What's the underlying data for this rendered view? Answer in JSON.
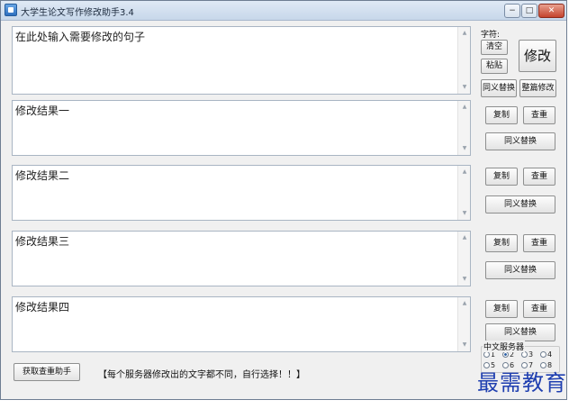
{
  "window": {
    "title": "大学生论文写作修改助手3.4",
    "controls": {
      "minimize": "−",
      "maximize": "□",
      "close": "✕"
    }
  },
  "input": {
    "placeholder": "在此处输入需要修改的句子"
  },
  "side_panel": {
    "char_label": "字符:",
    "clear": "清空",
    "paste": "粘贴",
    "modify": "修改",
    "synonym_replace": "同义替换",
    "whole_modify": "整篇修改"
  },
  "results": [
    {
      "label": "修改结果一",
      "copy": "复制",
      "check": "查重",
      "synonym": "同义替换"
    },
    {
      "label": "修改结果二",
      "copy": "复制",
      "check": "查重",
      "synonym": "同义替换"
    },
    {
      "label": "修改结果三",
      "copy": "复制",
      "check": "查重",
      "synonym": "同义替换"
    },
    {
      "label": "修改结果四",
      "copy": "复制",
      "check": "查重",
      "synonym": "同义替换"
    }
  ],
  "servers": {
    "label": "中文服务器",
    "options": [
      "1",
      "2",
      "3",
      "4",
      "5",
      "6",
      "7",
      "8"
    ],
    "selected": "2"
  },
  "footer": {
    "get_helper": "获取查重助手",
    "notice": "【每个服务器修改出的文字都不同，自行选择！！】"
  },
  "watermark": "最需教育"
}
